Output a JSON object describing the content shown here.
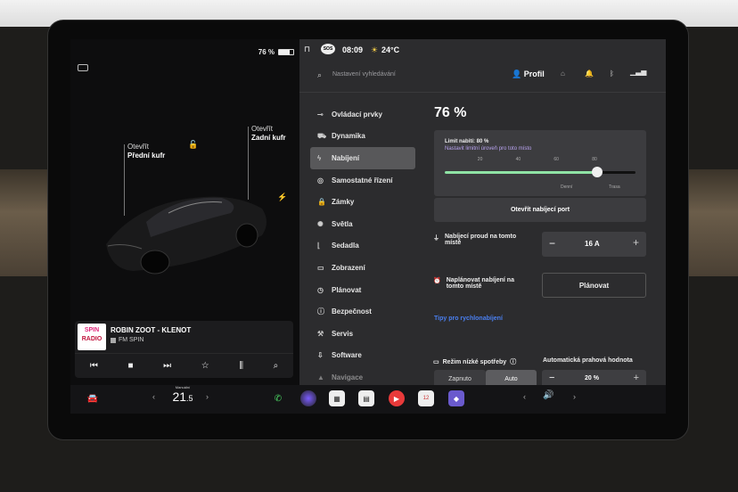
{
  "status": {
    "battery": "76 %",
    "sos": "SOS",
    "time": "08:09",
    "temp": "24°C"
  },
  "left": {
    "front_trunk_line1": "Otevřít",
    "front_trunk_line2": "Přední kufr",
    "rear_trunk_line1": "Otevřít",
    "rear_trunk_line2": "Zadní kufr"
  },
  "music": {
    "title": "ROBIN ZOOT - KLENOT",
    "station": "FM SPIN",
    "logo_top": "SPIN",
    "logo_bottom": "RADIO"
  },
  "search": {
    "placeholder": "Nastavení vyhledávání",
    "profile": "Profil"
  },
  "menu": [
    {
      "label": "Ovládací prvky",
      "icon": "toggle-icon"
    },
    {
      "label": "Dynamika",
      "icon": "car-icon"
    },
    {
      "label": "Nabíjení",
      "icon": "bolt-icon",
      "active": true
    },
    {
      "label": "Samostatné řízení",
      "icon": "steering-icon"
    },
    {
      "label": "Zámky",
      "icon": "lock-icon"
    },
    {
      "label": "Světla",
      "icon": "light-icon"
    },
    {
      "label": "Sedadla",
      "icon": "seat-icon"
    },
    {
      "label": "Zobrazení",
      "icon": "display-icon"
    },
    {
      "label": "Plánovat",
      "icon": "clock-icon"
    },
    {
      "label": "Bezpečnost",
      "icon": "shield-icon"
    },
    {
      "label": "Servis",
      "icon": "wrench-icon"
    },
    {
      "label": "Software",
      "icon": "download-icon"
    },
    {
      "label": "Navigace",
      "icon": "nav-icon"
    }
  ],
  "charging": {
    "percent": "76 %",
    "limit_label": "Limit nabití: 80 %",
    "limit_hint": "Nastavit limitní úroveň pro toto místo",
    "ticks": [
      "20",
      "40",
      "60",
      "80"
    ],
    "tick_home": "Denní",
    "tick_trip": "Trasa",
    "limit_fraction": 0.8,
    "open_port": "Otevřít nabíjecí port",
    "current_label": "Nabíjecí proud na tomto místě",
    "current_value": "16 A",
    "minus": "−",
    "plus": "+",
    "schedule_label": "Naplánovat nabíjení na tomto místě",
    "schedule_button": "Plánovat",
    "tips_link": "Tipy pro rychlonabíjení",
    "low_power_label": "Režim nízké spotřeby",
    "auto_threshold_label": "Automatická prahová hodnota",
    "off": "Zapnuto",
    "auto": "Auto",
    "threshold_value": "20 %"
  },
  "taskbar": {
    "climate_mode": "Manuální",
    "temp": "21",
    "temp_dec": ".5"
  },
  "colors": {
    "accent_green": "#8fe3a5",
    "link_blue": "#4a7ff0",
    "purple_hint": "#b9a3f0"
  }
}
